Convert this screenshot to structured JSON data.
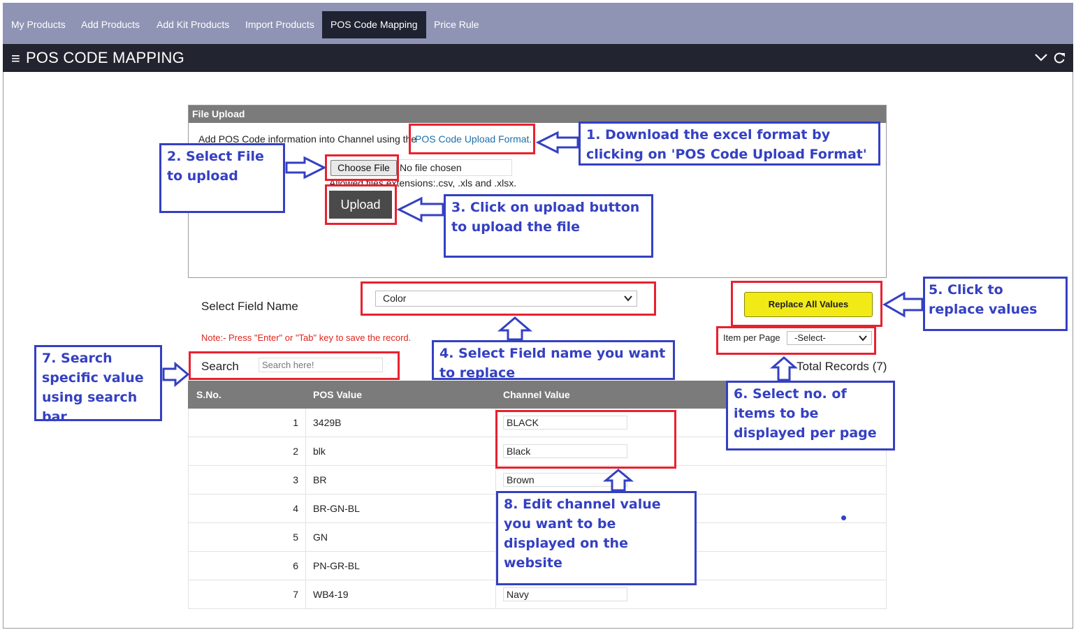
{
  "tabs": [
    {
      "label": "My Products",
      "active": false
    },
    {
      "label": "Add Products",
      "active": false
    },
    {
      "label": "Add Kit Products",
      "active": false
    },
    {
      "label": "Import Products",
      "active": false
    },
    {
      "label": "POS Code Mapping",
      "active": true
    },
    {
      "label": "Price Rule",
      "active": false
    }
  ],
  "header": {
    "menu_glyph": "≡",
    "title": "POS CODE MAPPING"
  },
  "upload": {
    "panel_title": "File Upload",
    "description": "Add POS Code information into Channel using the",
    "format_link": "POS Code Upload Format.",
    "choose_file_label": "Choose File",
    "file_status": "No file chosen",
    "allowed_text": "Allowed files extensions:.csv, .xls and .xlsx.",
    "upload_label": "Upload"
  },
  "field": {
    "label": "Select Field Name",
    "selected": "Color",
    "replace_label": "Replace All Values",
    "note": "Note:- Press \"Enter\" or \"Tab\" key to save the record.",
    "items_per_page_label": "Item per Page",
    "items_per_page_value": "-Select-",
    "search_label": "Search",
    "search_placeholder": "Search here!",
    "total_records": "Total Records (7)"
  },
  "table": {
    "headers": [
      "S.No.",
      "POS Value",
      "Channel Value"
    ],
    "rows": [
      {
        "sno": "1",
        "pos": "3429B",
        "channel": "BLACK"
      },
      {
        "sno": "2",
        "pos": "blk",
        "channel": "Black"
      },
      {
        "sno": "3",
        "pos": "BR",
        "channel": "Brown"
      },
      {
        "sno": "4",
        "pos": "BR-GN-BL",
        "channel": ""
      },
      {
        "sno": "5",
        "pos": "GN",
        "channel": ""
      },
      {
        "sno": "6",
        "pos": "PN-GR-BL",
        "channel": ""
      },
      {
        "sno": "7",
        "pos": "WB4-19",
        "channel": "Navy"
      }
    ]
  },
  "annotations": {
    "step1": "1. Download the excel format by clicking on 'POS Code Upload Format'",
    "step2": "2. Select File to upload",
    "step3": "3. Click on upload button to upload the file",
    "step4": "4. Select Field name you want to replace",
    "step5": "5. Click to replace values",
    "step6": "6. Select no. of items to be displayed per  page",
    "step7": "7. Search specific value using search bar",
    "step8": "8. Edit channel value you want to be displayed on the website"
  },
  "colors": {
    "tabbar": "#8f94b4",
    "header": "#22252f",
    "annotation_red": "#e8212f",
    "annotation_blue": "#3440c2",
    "replace_button": "#f2ea17",
    "note_red": "#e0241a"
  },
  "icons": [
    "menu-icon",
    "chevron-down-icon",
    "refresh-icon",
    "select-caret-icon"
  ]
}
